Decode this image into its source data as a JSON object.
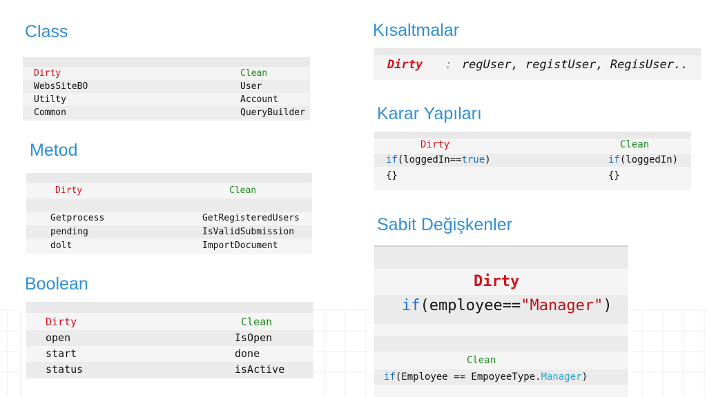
{
  "sections": {
    "class": {
      "title": "Class",
      "dirty_label": "Dirty",
      "clean_label": "Clean",
      "rows": [
        {
          "dirty": "WebsSiteBO",
          "clean": "User"
        },
        {
          "dirty": "Utilty",
          "clean": "Account"
        },
        {
          "dirty": "Common",
          "clean": "QueryBuilder"
        }
      ]
    },
    "metod": {
      "title": "Metod",
      "dirty_label": "Dirty",
      "clean_label": "Clean",
      "rows": [
        {
          "dirty": "Getprocess",
          "clean": "GetRegisteredUsers"
        },
        {
          "dirty": "pending",
          "clean": "IsValidSubmission"
        },
        {
          "dirty": "dolt",
          "clean": "ImportDocument"
        }
      ]
    },
    "boolean": {
      "title": "Boolean",
      "dirty_label": "Dirty",
      "clean_label": "Clean",
      "rows": [
        {
          "dirty": "open",
          "clean": "IsOpen"
        },
        {
          "dirty": "start",
          "clean": "done"
        },
        {
          "dirty": "status",
          "clean": "isActive"
        }
      ]
    },
    "kisaltmalar": {
      "title": "Kısaltmalar",
      "dirty_label": "Dirty",
      "separator": ":",
      "values": "regUser, registUser, RegisUser.."
    },
    "karar": {
      "title": "Karar Yapıları",
      "dirty_label": "Dirty",
      "clean_label": "Clean",
      "dirty_if_kw": "if",
      "dirty_if_open": "(loggedIn==",
      "dirty_if_true": "true",
      "dirty_if_close": ")",
      "dirty_braces": "{}",
      "clean_if_kw": "if",
      "clean_if_rest": "(loggedIn)",
      "clean_braces": "{}"
    },
    "sabit": {
      "title": "Sabit Değişkenler",
      "dirty_label": "Dirty",
      "dirty_if_kw": "if",
      "dirty_open": "(employee==",
      "dirty_string": "\"Manager\"",
      "dirty_close": ")",
      "clean_label": "Clean",
      "clean_if_kw": "if",
      "clean_open": "(Employee == EmpoyeeType.",
      "clean_member": "Manager",
      "clean_close": ")"
    }
  },
  "colors": {
    "heading": "#2f8fd6",
    "dirty": "#d0121b",
    "clean": "#1a8a1a",
    "keyword": "#1f6fc0",
    "panel_dark": "#ededed",
    "panel_light": "#f7f7f7"
  }
}
